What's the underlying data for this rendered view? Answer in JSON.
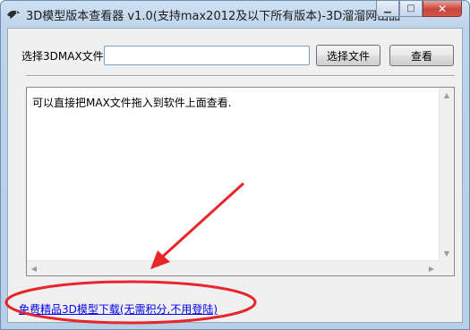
{
  "window": {
    "title": "3D模型版本查看器 v1.0(支持max2012及以下所有版本)-3D溜溜网出品",
    "min_glyph": "▁",
    "max_glyph": "□",
    "close_glyph": "✕"
  },
  "form": {
    "file_label": "选择3DMAX文件:",
    "file_value": "",
    "browse_label": "选择文件",
    "view_label": "查看"
  },
  "output": {
    "text": "可以直接把MAX文件拖入到软件上面查看."
  },
  "link": {
    "text": "免费精品3D模型下载(无需积分,不用登陆)"
  },
  "annotation": {
    "color": "#e8252b"
  },
  "icons": {
    "app": "bird-logo-icon",
    "scroll_up": "arrow-up-icon",
    "scroll_down": "arrow-down-icon",
    "scroll_left": "arrow-left-icon",
    "scroll_right": "arrow-right-icon"
  }
}
